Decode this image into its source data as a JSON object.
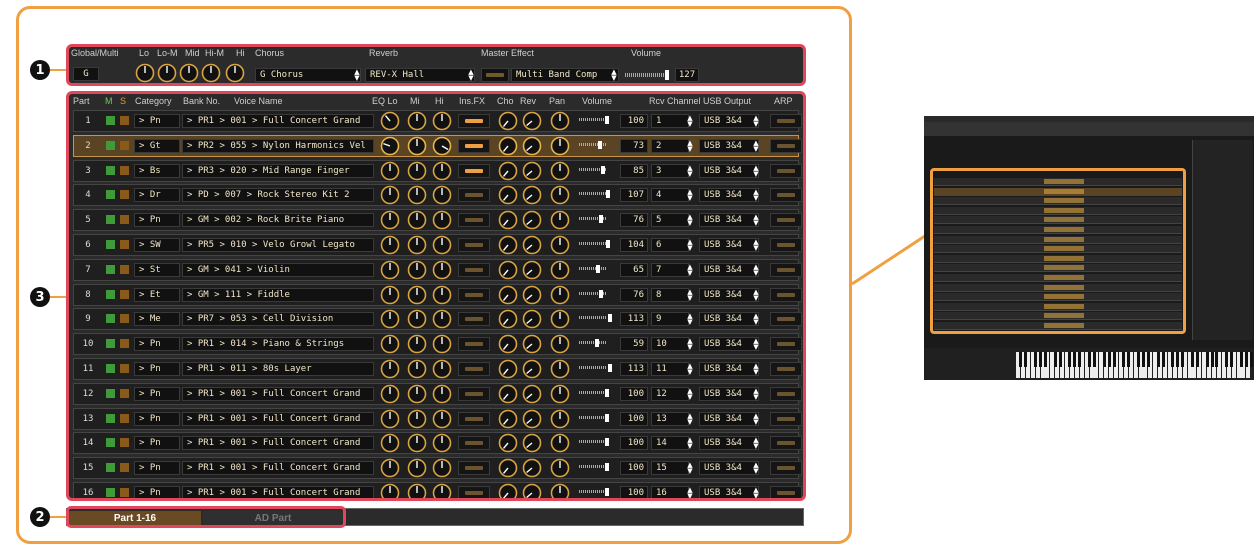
{
  "callouts": [
    "1",
    "2",
    "3"
  ],
  "global": {
    "headers": {
      "global_multi": "Global/Multi",
      "lo": "Lo",
      "lo_m": "Lo-M",
      "mid": "Mid",
      "hi_m": "Hi-M",
      "hi": "Hi",
      "chorus": "Chorus",
      "reverb": "Reverb",
      "master_effect": "Master Effect",
      "volume": "Volume"
    },
    "global_value": "G",
    "chorus": "G Chorus",
    "reverb": "REV-X Hall",
    "master_effect": "Multi Band Comp",
    "volume": "127"
  },
  "parts_header": {
    "part": "Part",
    "m": "M",
    "s": "S",
    "category": "Category",
    "bank_no": "Bank No.",
    "voice_name": "Voice Name",
    "eq_lo": "EQ Lo",
    "mi": "Mi",
    "hi": "Hi",
    "ins_fx": "Ins.FX",
    "cho": "Cho",
    "rev": "Rev",
    "pan": "Pan",
    "volume": "Volume",
    "rcv_channel": "Rcv Channel",
    "usb_output": "USB Output",
    "arp": "ARP"
  },
  "parts": [
    {
      "num": "1",
      "cat": "> Pn",
      "bank": "> PR1 > 001 > Full Concert Grand",
      "vol": "100",
      "ch": "1",
      "usb": "USB 3&4",
      "insfx": true
    },
    {
      "num": "2",
      "cat": "> Gt",
      "bank": "> PR2 > 055 > Nylon Harmonics Vel",
      "vol": "73",
      "ch": "2",
      "usb": "USB 3&4",
      "insfx": true
    },
    {
      "num": "3",
      "cat": "> Bs",
      "bank": "> PR3 > 020 > Mid Range Finger",
      "vol": "85",
      "ch": "3",
      "usb": "USB 3&4",
      "insfx": true
    },
    {
      "num": "4",
      "cat": "> Dr",
      "bank": "> PD  > 007 > Rock Stereo Kit 2",
      "vol": "107",
      "ch": "4",
      "usb": "USB 3&4",
      "insfx": false
    },
    {
      "num": "5",
      "cat": "> Pn",
      "bank": "> GM  > 002 > Rock Brite Piano",
      "vol": "76",
      "ch": "5",
      "usb": "USB 3&4",
      "insfx": false
    },
    {
      "num": "6",
      "cat": "> SW",
      "bank": "> PR5 > 010 > Velo Growl Legato",
      "vol": "104",
      "ch": "6",
      "usb": "USB 3&4",
      "insfx": false
    },
    {
      "num": "7",
      "cat": "> St",
      "bank": "> GM  > 041 > Violin",
      "vol": "65",
      "ch": "7",
      "usb": "USB 3&4",
      "insfx": false
    },
    {
      "num": "8",
      "cat": "> Et",
      "bank": "> GM  > 111 > Fiddle",
      "vol": "76",
      "ch": "8",
      "usb": "USB 3&4",
      "insfx": false
    },
    {
      "num": "9",
      "cat": "> Me",
      "bank": "> PR7 > 053 > Cell Division",
      "vol": "113",
      "ch": "9",
      "usb": "USB 3&4",
      "insfx": false
    },
    {
      "num": "10",
      "cat": "> Pn",
      "bank": "> PR1 > 014 > Piano & Strings",
      "vol": "59",
      "ch": "10",
      "usb": "USB 3&4",
      "insfx": false
    },
    {
      "num": "11",
      "cat": "> Pn",
      "bank": "> PR1 > 011 > 80s Layer",
      "vol": "113",
      "ch": "11",
      "usb": "USB 3&4",
      "insfx": false
    },
    {
      "num": "12",
      "cat": "> Pn",
      "bank": "> PR1 > 001 > Full Concert Grand",
      "vol": "100",
      "ch": "12",
      "usb": "USB 3&4",
      "insfx": false
    },
    {
      "num": "13",
      "cat": "> Pn",
      "bank": "> PR1 > 001 > Full Concert Grand",
      "vol": "100",
      "ch": "13",
      "usb": "USB 3&4",
      "insfx": false
    },
    {
      "num": "14",
      "cat": "> Pn",
      "bank": "> PR1 > 001 > Full Concert Grand",
      "vol": "100",
      "ch": "14",
      "usb": "USB 3&4",
      "insfx": false
    },
    {
      "num": "15",
      "cat": "> Pn",
      "bank": "> PR1 > 001 > Full Concert Grand",
      "vol": "100",
      "ch": "15",
      "usb": "USB 3&4",
      "insfx": false
    },
    {
      "num": "16",
      "cat": "> Pn",
      "bank": "> PR1 > 001 > Full Concert Grand",
      "vol": "100",
      "ch": "16",
      "usb": "USB 3&4",
      "insfx": false
    }
  ],
  "tabs": [
    "Part 1-16",
    "AD Part"
  ],
  "colors": {
    "accent_orange": "#f0a040",
    "highlight_red": "#e0475a",
    "knob_gold": "#d9a441",
    "panel_dark": "#2b2b2b",
    "mute_green": "#3f9b3a",
    "solo_orange": "#c87a1e"
  }
}
